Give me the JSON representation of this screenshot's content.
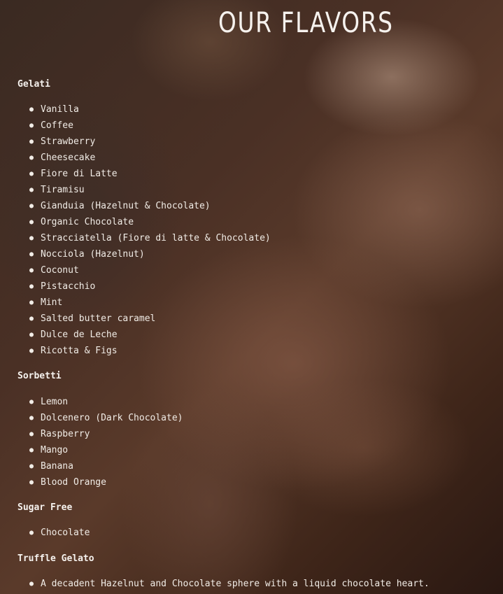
{
  "page": {
    "title": "OUR FLAVORS"
  },
  "sections": [
    {
      "heading": "Gelati",
      "items": [
        "Vanilla",
        "Coffee",
        "Strawberry",
        "Cheesecake",
        "Fiore di Latte",
        "Tiramisu",
        "Gianduia (Hazelnut & Chocolate)",
        "Organic Chocolate",
        "Stracciatella (Fiore di latte & Chocolate)",
        "Nocciola (Hazelnut)",
        "Coconut",
        "Pistacchio",
        "Mint",
        "Salted butter caramel",
        "Dulce de Leche",
        "Ricotta & Figs"
      ]
    },
    {
      "heading": "Sorbetti",
      "items": [
        "Lemon",
        "Dolcenero (Dark Chocolate)",
        "Raspberry",
        "Mango",
        "Banana",
        "Blood Orange"
      ]
    },
    {
      "heading": "Sugar Free",
      "items": [
        "Chocolate"
      ]
    },
    {
      "heading": "Truffle Gelato",
      "items": [
        "A decadent Hazelnut and Chocolate sphere with a liquid chocolate heart."
      ]
    }
  ],
  "colors": {
    "text": "#f1ece6",
    "background": "#3a2419"
  }
}
